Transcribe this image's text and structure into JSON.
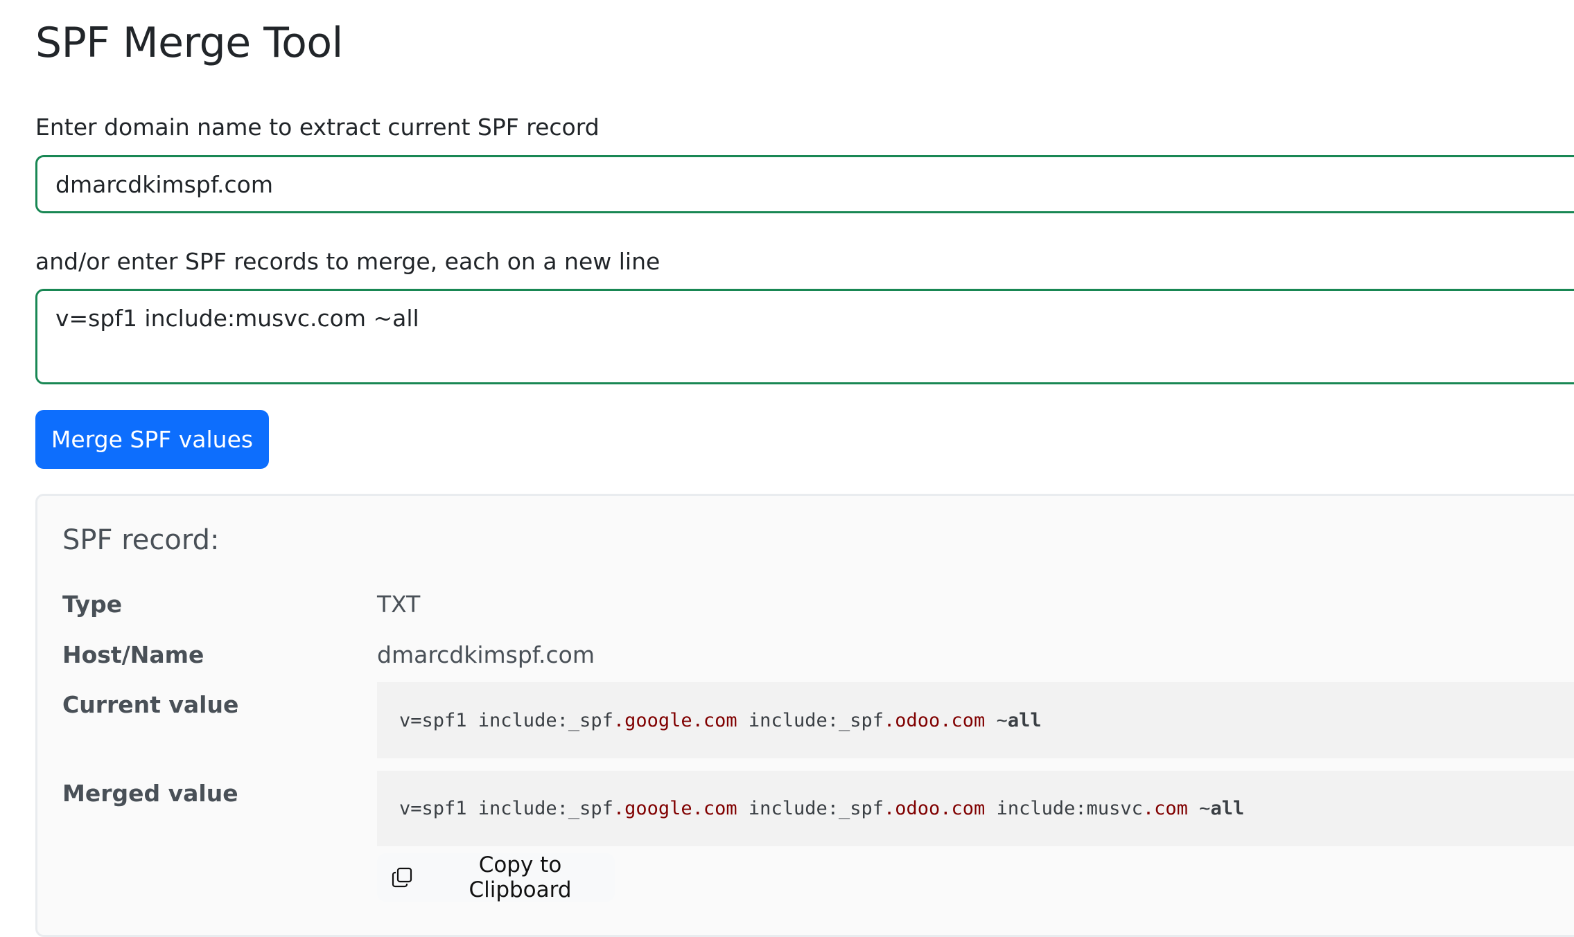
{
  "page": {
    "title": "SPF Merge Tool"
  },
  "form": {
    "domain_label": "Enter domain name to extract current SPF record",
    "domain_value": "dmarcdkimspf.com",
    "records_label": "and/or enter SPF records to merge, each on a new line",
    "records_value": "v=spf1 include:musvc.com ~all",
    "submit_label": "Merge SPF values"
  },
  "result": {
    "heading": "SPF record:",
    "rows": [
      {
        "label": "Type",
        "value": "TXT"
      },
      {
        "label": "Host/Name",
        "value": "dmarcdkimspf.com"
      },
      {
        "label": "Current value"
      },
      {
        "label": "Merged value"
      }
    ],
    "current_value_tokens": [
      {
        "text": "v=spf1 include:_spf",
        "style": "plain"
      },
      {
        "text": ".google.com",
        "style": "domain"
      },
      {
        "text": " include:_spf",
        "style": "plain"
      },
      {
        "text": ".odoo.com",
        "style": "domain"
      },
      {
        "text": " ~",
        "style": "plain"
      },
      {
        "text": "all",
        "style": "bold"
      }
    ],
    "merged_value_tokens": [
      {
        "text": "v=spf1 include:_spf",
        "style": "plain"
      },
      {
        "text": ".google.com",
        "style": "domain"
      },
      {
        "text": " include:_spf",
        "style": "plain"
      },
      {
        "text": ".odoo.com",
        "style": "domain"
      },
      {
        "text": " include:musvc",
        "style": "plain"
      },
      {
        "text": ".com",
        "style": "domain"
      },
      {
        "text": " ~",
        "style": "plain"
      },
      {
        "text": "all",
        "style": "bold"
      }
    ],
    "copy_label": "Copy to Clipboard",
    "copy_icon": "copy-icon"
  },
  "colors": {
    "primary": "#0d6efd",
    "valid_border": "#198754",
    "domain_token": "#800000"
  }
}
